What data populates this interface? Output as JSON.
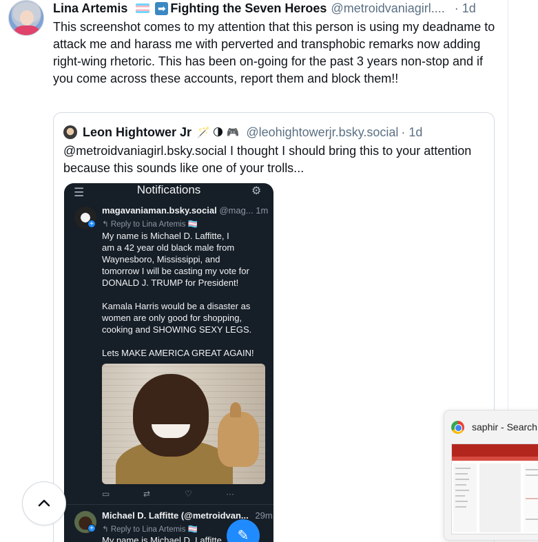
{
  "post": {
    "author_name": "Lina Artemis",
    "arrow_symbol": "➡",
    "author_tag": "Fighting the Seven Heroes",
    "handle": "@metroidvaniagirl....",
    "time": "· 1d",
    "text": "This screenshot comes to my attention that this person is using my deadname to attack me and harass me with perverted and transphobic remarks now adding right-wing rhetoric.  This has been on-going for the past 3 years non-stop and if you come across these accounts, report them and block them!!"
  },
  "quote": {
    "author_name": "Leon Hightower Jr",
    "emojis": "🪄 🌗 🎮",
    "handle": "@leohightowerjr.bsky.social",
    "time": "· 1d",
    "text": "@metroidvaniagirl.bsky.social I thought I should bring this to your attention because this sounds like one of your trolls..."
  },
  "screenshot": {
    "menu_icon": "☰",
    "title": "Notifications",
    "settings_icon": "⚙",
    "post1": {
      "username": "magavaniaman.bsky.social",
      "handle": "@mag...",
      "time": "1m",
      "reply_to": "↰ Reply to Lina Artemis 🏳️‍⚧️",
      "body": "My name is Michael D. Laffitte, I\nam a 42 year old black male from\nWaynesboro, Mississippi, and\ntomorrow I will be casting my vote for\nDONALD J. TRUMP for President!\n\nKamala Harris would be a disaster as\nwomen are only good for shopping,\ncooking and SHOWING SEXY LEGS.\n\nLets MAKE AMERICA GREAT AGAIN!"
    },
    "actions": {
      "reply": "▭",
      "repost": "⇄",
      "like": "♡",
      "more": "···"
    },
    "post2": {
      "username": "Michael D. Laffitte (@metroidvan...",
      "time": "29m",
      "reply_to": "↰ Reply to Lina Artemis 🏳️‍⚧️",
      "body": "My name is Michael D. Laffitte"
    },
    "compose_icon": "✎"
  },
  "scroll_top_icon": "chevron-up-icon",
  "taskbar_preview": {
    "title": "saphir - Search"
  }
}
